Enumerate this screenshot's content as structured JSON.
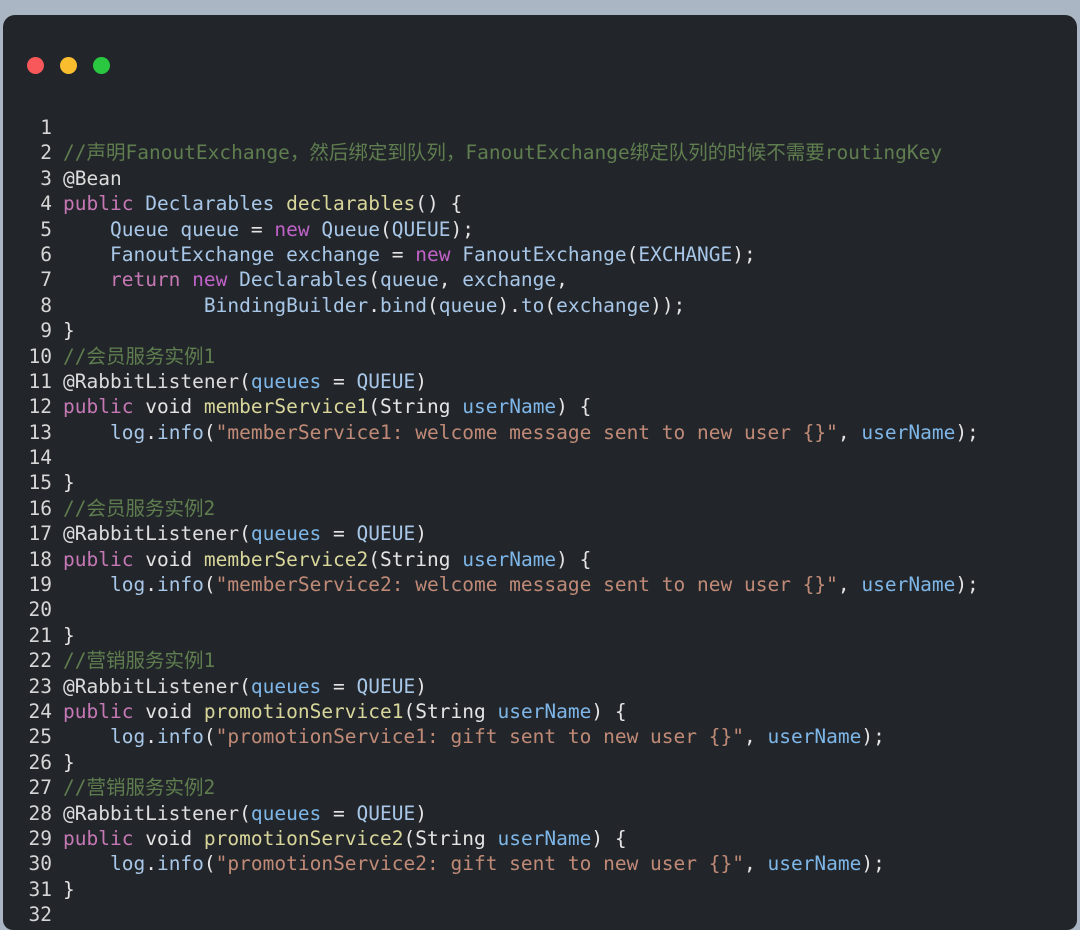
{
  "window": {
    "title": "",
    "controls": [
      {
        "name": "close",
        "label": "",
        "color": "#f8585a"
      },
      {
        "name": "minimize",
        "label": "",
        "color": "#f9bd2e"
      },
      {
        "name": "zoom",
        "label": "",
        "color": "#2ac840"
      }
    ],
    "background": "#22262a",
    "page_background": "#aab6c4"
  },
  "editor": {
    "language": "java",
    "font_size_px": 19.5,
    "gutter_color": "#d6d6d6",
    "total_lines": 32,
    "theme_colors": {
      "comment": "#5f7d4f",
      "keyword": "#c678b5",
      "type": "#a8c7e8",
      "function": "#d8d69a",
      "variable": "#7eb6e8",
      "string": "#c08a77",
      "plain": "#e4e4e4"
    },
    "lines": [
      {
        "n": "1",
        "text": ""
      },
      {
        "n": "2",
        "text": "//声明FanoutExchange，然后绑定到队列，FanoutExchange绑定队列的时候不需要routingKey"
      },
      {
        "n": "3",
        "text": "@Bean"
      },
      {
        "n": "4",
        "text": "public Declarables declarables() {"
      },
      {
        "n": "5",
        "text": "    Queue queue = new Queue(QUEUE);"
      },
      {
        "n": "6",
        "text": "    FanoutExchange exchange = new FanoutExchange(EXCHANGE);"
      },
      {
        "n": "7",
        "text": "    return new Declarables(queue, exchange,"
      },
      {
        "n": "8",
        "text": "            BindingBuilder.bind(queue).to(exchange));"
      },
      {
        "n": "9",
        "text": "}"
      },
      {
        "n": "10",
        "text": "//会员服务实例1"
      },
      {
        "n": "11",
        "text": "@RabbitListener(queues = QUEUE)"
      },
      {
        "n": "12",
        "text": "public void memberService1(String userName) {"
      },
      {
        "n": "13",
        "text": "    log.info(\"memberService1: welcome message sent to new user {}\", userName);"
      },
      {
        "n": "14",
        "text": ""
      },
      {
        "n": "15",
        "text": "}"
      },
      {
        "n": "16",
        "text": "//会员服务实例2"
      },
      {
        "n": "17",
        "text": "@RabbitListener(queues = QUEUE)"
      },
      {
        "n": "18",
        "text": "public void memberService2(String userName) {"
      },
      {
        "n": "19",
        "text": "    log.info(\"memberService2: welcome message sent to new user {}\", userName);"
      },
      {
        "n": "20",
        "text": ""
      },
      {
        "n": "21",
        "text": "}"
      },
      {
        "n": "22",
        "text": "//营销服务实例1"
      },
      {
        "n": "23",
        "text": "@RabbitListener(queues = QUEUE)"
      },
      {
        "n": "24",
        "text": "public void promotionService1(String userName) {"
      },
      {
        "n": "25",
        "text": "    log.info(\"promotionService1: gift sent to new user {}\", userName);"
      },
      {
        "n": "26",
        "text": "}"
      },
      {
        "n": "27",
        "text": "//营销服务实例2"
      },
      {
        "n": "28",
        "text": "@RabbitListener(queues = QUEUE)"
      },
      {
        "n": "29",
        "text": "public void promotionService2(String userName) {"
      },
      {
        "n": "30",
        "text": "    log.info(\"promotionService2: gift sent to new user {}\", userName);"
      },
      {
        "n": "31",
        "text": "}"
      },
      {
        "n": "32",
        "text": ""
      }
    ],
    "line_tokens": [
      [],
      [
        {
          "t": "//声明FanoutExchange，然后绑定到队列，FanoutExchange绑定队列的时候不需要routingKey",
          "c": "c-comment"
        }
      ],
      [
        {
          "t": "@Bean",
          "c": "c-ann"
        }
      ],
      [
        {
          "t": "public",
          "c": "c-kw"
        },
        {
          "t": " ",
          "c": "c-plain"
        },
        {
          "t": "Declarables",
          "c": "c-type"
        },
        {
          "t": " ",
          "c": "c-plain"
        },
        {
          "t": "declarables",
          "c": "c-fn"
        },
        {
          "t": "() {",
          "c": "c-plain"
        }
      ],
      [
        {
          "t": "    ",
          "c": "c-plain"
        },
        {
          "t": "Queue",
          "c": "c-type"
        },
        {
          "t": " ",
          "c": "c-plain"
        },
        {
          "t": "queue",
          "c": "c-type"
        },
        {
          "t": " = ",
          "c": "c-plain"
        },
        {
          "t": "new",
          "c": "c-kw2"
        },
        {
          "t": " ",
          "c": "c-plain"
        },
        {
          "t": "Queue",
          "c": "c-type"
        },
        {
          "t": "(",
          "c": "c-plain"
        },
        {
          "t": "QUEUE",
          "c": "c-type"
        },
        {
          "t": ");",
          "c": "c-plain"
        }
      ],
      [
        {
          "t": "    ",
          "c": "c-plain"
        },
        {
          "t": "FanoutExchange",
          "c": "c-type"
        },
        {
          "t": " ",
          "c": "c-plain"
        },
        {
          "t": "exchange",
          "c": "c-type"
        },
        {
          "t": " = ",
          "c": "c-plain"
        },
        {
          "t": "new",
          "c": "c-kw2"
        },
        {
          "t": " ",
          "c": "c-plain"
        },
        {
          "t": "FanoutExchange",
          "c": "c-type"
        },
        {
          "t": "(",
          "c": "c-plain"
        },
        {
          "t": "EXCHANGE",
          "c": "c-type"
        },
        {
          "t": ");",
          "c": "c-plain"
        }
      ],
      [
        {
          "t": "    ",
          "c": "c-plain"
        },
        {
          "t": "return",
          "c": "c-kw"
        },
        {
          "t": " ",
          "c": "c-plain"
        },
        {
          "t": "new",
          "c": "c-kw2"
        },
        {
          "t": " ",
          "c": "c-plain"
        },
        {
          "t": "Declarables",
          "c": "c-type"
        },
        {
          "t": "(",
          "c": "c-plain"
        },
        {
          "t": "queue",
          "c": "c-type"
        },
        {
          "t": ", ",
          "c": "c-plain"
        },
        {
          "t": "exchange",
          "c": "c-type"
        },
        {
          "t": ",",
          "c": "c-plain"
        }
      ],
      [
        {
          "t": "            ",
          "c": "c-plain"
        },
        {
          "t": "BindingBuilder",
          "c": "c-type"
        },
        {
          "t": ".",
          "c": "c-plain"
        },
        {
          "t": "bind",
          "c": "c-type"
        },
        {
          "t": "(",
          "c": "c-plain"
        },
        {
          "t": "queue",
          "c": "c-type"
        },
        {
          "t": ").",
          "c": "c-plain"
        },
        {
          "t": "to",
          "c": "c-type"
        },
        {
          "t": "(",
          "c": "c-plain"
        },
        {
          "t": "exchange",
          "c": "c-type"
        },
        {
          "t": "));",
          "c": "c-plain"
        }
      ],
      [
        {
          "t": "}",
          "c": "c-plain"
        }
      ],
      [
        {
          "t": "//会员服务实例1",
          "c": "c-comment"
        }
      ],
      [
        {
          "t": "@RabbitListener",
          "c": "c-ann"
        },
        {
          "t": "(",
          "c": "c-plain"
        },
        {
          "t": "queues",
          "c": "c-var"
        },
        {
          "t": " = ",
          "c": "c-plain"
        },
        {
          "t": "QUEUE",
          "c": "c-type"
        },
        {
          "t": ")",
          "c": "c-plain"
        }
      ],
      [
        {
          "t": "public",
          "c": "c-kw"
        },
        {
          "t": " ",
          "c": "c-plain"
        },
        {
          "t": "void",
          "c": "c-plain"
        },
        {
          "t": " ",
          "c": "c-plain"
        },
        {
          "t": "memberService1",
          "c": "c-fn"
        },
        {
          "t": "(",
          "c": "c-plain"
        },
        {
          "t": "String",
          "c": "c-plain"
        },
        {
          "t": " ",
          "c": "c-plain"
        },
        {
          "t": "userName",
          "c": "c-var"
        },
        {
          "t": ") {",
          "c": "c-plain"
        }
      ],
      [
        {
          "t": "    ",
          "c": "c-plain"
        },
        {
          "t": "log",
          "c": "c-type"
        },
        {
          "t": ".",
          "c": "c-plain"
        },
        {
          "t": "info",
          "c": "c-type"
        },
        {
          "t": "(",
          "c": "c-plain"
        },
        {
          "t": "\"memberService1: welcome message sent to new user {}\"",
          "c": "c-str"
        },
        {
          "t": ", ",
          "c": "c-plain"
        },
        {
          "t": "userName",
          "c": "c-var"
        },
        {
          "t": ");",
          "c": "c-plain"
        }
      ],
      [],
      [
        {
          "t": "}",
          "c": "c-plain"
        }
      ],
      [
        {
          "t": "//会员服务实例2",
          "c": "c-comment"
        }
      ],
      [
        {
          "t": "@RabbitListener",
          "c": "c-ann"
        },
        {
          "t": "(",
          "c": "c-plain"
        },
        {
          "t": "queues",
          "c": "c-var"
        },
        {
          "t": " = ",
          "c": "c-plain"
        },
        {
          "t": "QUEUE",
          "c": "c-type"
        },
        {
          "t": ")",
          "c": "c-plain"
        }
      ],
      [
        {
          "t": "public",
          "c": "c-kw"
        },
        {
          "t": " ",
          "c": "c-plain"
        },
        {
          "t": "void",
          "c": "c-plain"
        },
        {
          "t": " ",
          "c": "c-plain"
        },
        {
          "t": "memberService2",
          "c": "c-fn"
        },
        {
          "t": "(",
          "c": "c-plain"
        },
        {
          "t": "String",
          "c": "c-plain"
        },
        {
          "t": " ",
          "c": "c-plain"
        },
        {
          "t": "userName",
          "c": "c-var"
        },
        {
          "t": ") {",
          "c": "c-plain"
        }
      ],
      [
        {
          "t": "    ",
          "c": "c-plain"
        },
        {
          "t": "log",
          "c": "c-type"
        },
        {
          "t": ".",
          "c": "c-plain"
        },
        {
          "t": "info",
          "c": "c-type"
        },
        {
          "t": "(",
          "c": "c-plain"
        },
        {
          "t": "\"memberService2: welcome message sent to new user {}\"",
          "c": "c-str"
        },
        {
          "t": ", ",
          "c": "c-plain"
        },
        {
          "t": "userName",
          "c": "c-var"
        },
        {
          "t": ");",
          "c": "c-plain"
        }
      ],
      [],
      [
        {
          "t": "}",
          "c": "c-plain"
        }
      ],
      [
        {
          "t": "//营销服务实例1",
          "c": "c-comment"
        }
      ],
      [
        {
          "t": "@RabbitListener",
          "c": "c-ann"
        },
        {
          "t": "(",
          "c": "c-plain"
        },
        {
          "t": "queues",
          "c": "c-var"
        },
        {
          "t": " = ",
          "c": "c-plain"
        },
        {
          "t": "QUEUE",
          "c": "c-type"
        },
        {
          "t": ")",
          "c": "c-plain"
        }
      ],
      [
        {
          "t": "public",
          "c": "c-kw"
        },
        {
          "t": " ",
          "c": "c-plain"
        },
        {
          "t": "void",
          "c": "c-plain"
        },
        {
          "t": " ",
          "c": "c-plain"
        },
        {
          "t": "promotionService1",
          "c": "c-fn"
        },
        {
          "t": "(",
          "c": "c-plain"
        },
        {
          "t": "String",
          "c": "c-plain"
        },
        {
          "t": " ",
          "c": "c-plain"
        },
        {
          "t": "userName",
          "c": "c-var"
        },
        {
          "t": ") {",
          "c": "c-plain"
        }
      ],
      [
        {
          "t": "    ",
          "c": "c-plain"
        },
        {
          "t": "log",
          "c": "c-type"
        },
        {
          "t": ".",
          "c": "c-plain"
        },
        {
          "t": "info",
          "c": "c-type"
        },
        {
          "t": "(",
          "c": "c-plain"
        },
        {
          "t": "\"promotionService1: gift sent to new user {}\"",
          "c": "c-str"
        },
        {
          "t": ", ",
          "c": "c-plain"
        },
        {
          "t": "userName",
          "c": "c-var"
        },
        {
          "t": ");",
          "c": "c-plain"
        }
      ],
      [
        {
          "t": "}",
          "c": "c-plain"
        }
      ],
      [
        {
          "t": "//营销服务实例2",
          "c": "c-comment"
        }
      ],
      [
        {
          "t": "@RabbitListener",
          "c": "c-ann"
        },
        {
          "t": "(",
          "c": "c-plain"
        },
        {
          "t": "queues",
          "c": "c-var"
        },
        {
          "t": " = ",
          "c": "c-plain"
        },
        {
          "t": "QUEUE",
          "c": "c-type"
        },
        {
          "t": ")",
          "c": "c-plain"
        }
      ],
      [
        {
          "t": "public",
          "c": "c-kw"
        },
        {
          "t": " ",
          "c": "c-plain"
        },
        {
          "t": "void",
          "c": "c-plain"
        },
        {
          "t": " ",
          "c": "c-plain"
        },
        {
          "t": "promotionService2",
          "c": "c-fn"
        },
        {
          "t": "(",
          "c": "c-plain"
        },
        {
          "t": "String",
          "c": "c-plain"
        },
        {
          "t": " ",
          "c": "c-plain"
        },
        {
          "t": "userName",
          "c": "c-var"
        },
        {
          "t": ") {",
          "c": "c-plain"
        }
      ],
      [
        {
          "t": "    ",
          "c": "c-plain"
        },
        {
          "t": "log",
          "c": "c-type"
        },
        {
          "t": ".",
          "c": "c-plain"
        },
        {
          "t": "info",
          "c": "c-type"
        },
        {
          "t": "(",
          "c": "c-plain"
        },
        {
          "t": "\"promotionService2: gift sent to new user {}\"",
          "c": "c-str"
        },
        {
          "t": ", ",
          "c": "c-plain"
        },
        {
          "t": "userName",
          "c": "c-var"
        },
        {
          "t": ");",
          "c": "c-plain"
        }
      ],
      [
        {
          "t": "}",
          "c": "c-plain"
        }
      ],
      []
    ]
  }
}
